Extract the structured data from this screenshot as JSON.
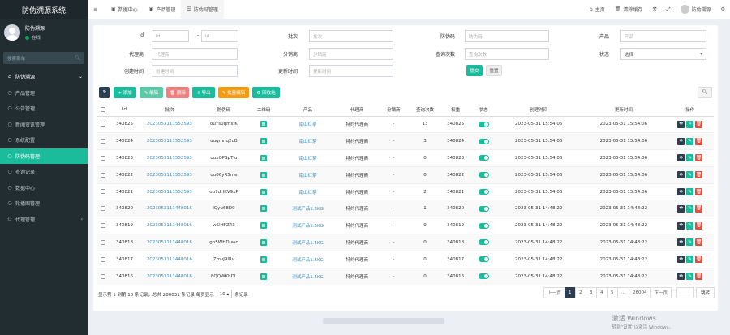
{
  "app": {
    "title": "防伪溯源系统"
  },
  "user": {
    "name": "防伪溯源",
    "status": "在线"
  },
  "sidebar": {
    "search_placeholder": "搜索菜单",
    "items": [
      {
        "label": "防伪溯源",
        "icon": "home-icon",
        "type": "parent"
      },
      {
        "label": "产品管理",
        "icon": "circle-icon",
        "type": "child"
      },
      {
        "label": "公告管理",
        "icon": "circle-icon",
        "type": "child"
      },
      {
        "label": "新闻资讯管理",
        "icon": "circle-icon",
        "type": "child"
      },
      {
        "label": "系统配置",
        "icon": "circle-icon",
        "type": "child"
      },
      {
        "label": "防伪码管理",
        "icon": "circle-icon",
        "type": "active"
      },
      {
        "label": "查询记录",
        "icon": "circle-icon",
        "type": "child"
      },
      {
        "label": "数据中心",
        "icon": "circle-icon",
        "type": "child"
      },
      {
        "label": "轮播图管理",
        "icon": "circle-icon",
        "type": "child"
      },
      {
        "label": "代理管理",
        "icon": "users-icon",
        "type": "child"
      }
    ]
  },
  "topbar": {
    "tabs": [
      {
        "label": "",
        "icon": "menu-icon"
      },
      {
        "label": "数据中心",
        "icon": "dashboard-icon"
      },
      {
        "label": "产品管理",
        "icon": "dashboard-icon"
      },
      {
        "label": "防伪码管理",
        "icon": "list-icon"
      }
    ],
    "right": [
      {
        "label": "主页",
        "icon": "home-icon"
      },
      {
        "label": "清除缓存",
        "icon": "trash-icon"
      },
      {
        "label": "",
        "icon": "wrench-icon"
      },
      {
        "label": "",
        "icon": "expand-icon"
      },
      {
        "label": "防伪溯源",
        "icon": "avatar-icon"
      },
      {
        "label": "",
        "icon": "gears-icon"
      }
    ]
  },
  "search": {
    "id_label": "Id",
    "id_from_placeholder": "Id",
    "id_to_placeholder": "Id",
    "id_sep": "-",
    "batch_label": "批次",
    "batch_placeholder": "批次",
    "code_label": "防伪码",
    "code_placeholder": "防伪码",
    "product_label": "产品",
    "product_placeholder": "产品",
    "agent_label": "代理商",
    "agent_placeholder": "代理商",
    "dist_label": "分销商",
    "dist_placeholder": "分销商",
    "query_label": "查询次数",
    "query_placeholder": "查询次数",
    "status_label": "状态",
    "status_value": "选择",
    "created_label": "创建时间",
    "created_placeholder": "创建时间",
    "updated_label": "更新时间",
    "updated_placeholder": "更新时间",
    "submit": "提交",
    "reset": "重置"
  },
  "toolbar": {
    "refresh": "",
    "add": "+ 添加",
    "edit": "✎ 编辑",
    "delete": "🗑 删除",
    "export": "⇩ 导出",
    "batch_edit": "✎ 批量编辑",
    "recycle": "♻ 回收站"
  },
  "table": {
    "headers": [
      "",
      "Id",
      "批次",
      "防伪码",
      "二维码",
      "产品",
      "代理商",
      "分销商",
      "查询次数",
      "权重",
      "状态",
      "创建时间",
      "更新时间",
      "操作"
    ],
    "rows": [
      {
        "id": "340825",
        "batch": "2023053111552593",
        "code": "ouYsuqmxlK",
        "product": "南山红茶",
        "agent": "特约代理商",
        "dist": "-",
        "queries": "13",
        "weight": "340825",
        "created": "2023-05-31 15:54:06",
        "updated": "2023-05-31 15:54:06"
      },
      {
        "id": "340824",
        "batch": "2023053111552593",
        "code": "uuqmnq2uB",
        "product": "南山红茶",
        "agent": "特约代理商",
        "dist": "-",
        "queries": "3",
        "weight": "340824",
        "created": "2023-05-31 15:54:06",
        "updated": "2023-05-31 15:54:06"
      },
      {
        "id": "340823",
        "batch": "2023053111552593",
        "code": "ouxQPSpTlu",
        "product": "南山红茶",
        "agent": "特约代理商",
        "dist": "-",
        "queries": "0",
        "weight": "340823",
        "created": "2023-05-31 15:54:06",
        "updated": "2023-05-31 15:54:06"
      },
      {
        "id": "340822",
        "batch": "2023053111552593",
        "code": "ou06yR5me",
        "product": "南山红茶",
        "agent": "特约代理商",
        "dist": "-",
        "queries": "0",
        "weight": "340822",
        "created": "2023-05-31 15:54:06",
        "updated": "2023-05-31 15:54:06"
      },
      {
        "id": "340821",
        "batch": "2023053111552593",
        "code": "ou7dHKV9xP",
        "product": "南山红茶",
        "agent": "特约代理商",
        "dist": "-",
        "queries": "2",
        "weight": "340821",
        "created": "2023-05-31 15:54:06",
        "updated": "2023-05-31 15:54:06"
      },
      {
        "id": "340820",
        "batch": "2023053111448016",
        "code": "lQyu68D9",
        "product": "测试产品1.5KG",
        "agent": "特约代理商",
        "dist": "-",
        "queries": "1",
        "weight": "340820",
        "created": "2023-05-31 14:48:22",
        "updated": "2023-05-31 14:48:22"
      },
      {
        "id": "340819",
        "batch": "2023053111448016",
        "code": "wSlHFZ43",
        "product": "测试产品1.5KG",
        "agent": "特约代理商",
        "dist": "-",
        "queries": "0",
        "weight": "340819",
        "created": "2023-05-31 14:48:22",
        "updated": "2023-05-31 14:48:22"
      },
      {
        "id": "340818",
        "batch": "2023053111448016",
        "code": "gh5WHDuwc",
        "product": "测试产品1.5KG",
        "agent": "特约代理商",
        "dist": "-",
        "queries": "0",
        "weight": "340818",
        "created": "2023-05-31 14:48:22",
        "updated": "2023-05-31 14:48:22"
      },
      {
        "id": "340817",
        "batch": "2023053111448016",
        "code": "ZmvJ9IRv",
        "product": "测试产品1.5KG",
        "agent": "特约代理商",
        "dist": "-",
        "queries": "0",
        "weight": "340817",
        "created": "2023-05-31 14:48:22",
        "updated": "2023-05-31 14:48:22"
      },
      {
        "id": "340816",
        "batch": "2023053111448016",
        "code": "8QQWKhDL",
        "product": "测试产品1.5KG",
        "agent": "特约代理商",
        "dist": "-",
        "queries": "0",
        "weight": "340816",
        "created": "2023-05-31 14:48:22",
        "updated": "2023-05-31 14:48:22"
      }
    ]
  },
  "footer": {
    "info_prefix": "显示第 1 到第 10 条记录，总共 280031 条记录 每页显示",
    "page_size": "10",
    "info_suffix": "条记录",
    "pages": [
      "上一页",
      "1",
      "2",
      "3",
      "4",
      "5",
      "...",
      "28004",
      "下一页"
    ],
    "active_page": "1",
    "jump": "跳转"
  },
  "watermark": {
    "title": "激活 Windows",
    "sub": "转到\"设置\"以激活 Windows。"
  },
  "colors": {
    "sidebar": "#222d32",
    "accent": "#1abc9c",
    "link": "#3c8dbc",
    "danger": "#e74c3c",
    "warning": "#f39c12"
  }
}
